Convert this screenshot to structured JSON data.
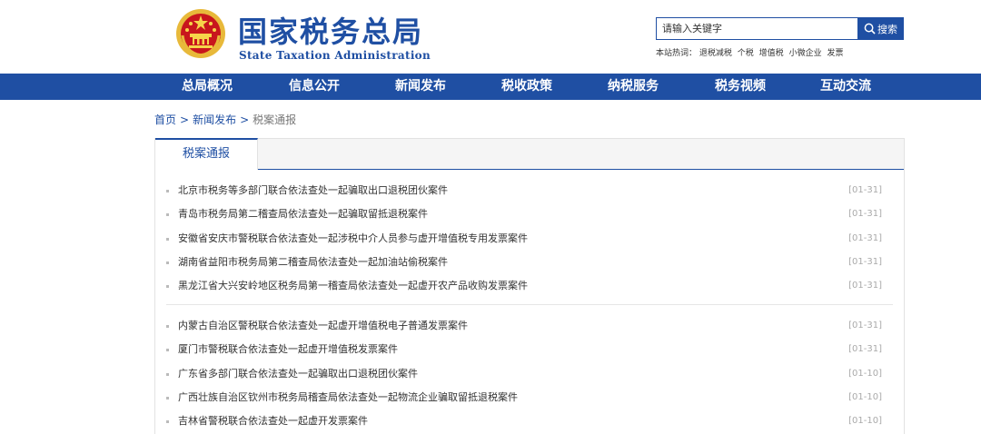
{
  "header": {
    "title_cn": "国家税务总局",
    "title_en": "State Taxation Administration",
    "search_placeholder": "请输入关键字",
    "search_button": "搜索",
    "hot_label": "本站热词：",
    "hot_words": [
      "退税减税",
      "个税",
      "增值税",
      "小微企业",
      "发票"
    ]
  },
  "nav": [
    "总局概况",
    "信息公开",
    "新闻发布",
    "税收政策",
    "纳税服务",
    "税务视频",
    "互动交流"
  ],
  "breadcrumb": {
    "home": "首页",
    "news": "新闻发布",
    "current": "税案通报",
    "separator": ">"
  },
  "tab": {
    "label": "税案通报"
  },
  "group_a": [
    {
      "title": "北京市税务等多部门联合依法查处一起骗取出口退税团伙案件",
      "date": "[01-31]"
    },
    {
      "title": "青岛市税务局第二稽查局依法查处一起骗取留抵退税案件",
      "date": "[01-31]"
    },
    {
      "title": "安徽省安庆市警税联合依法查处一起涉税中介人员参与虚开增值税专用发票案件",
      "date": "[01-31]"
    },
    {
      "title": "湖南省益阳市税务局第二稽查局依法查处一起加油站偷税案件",
      "date": "[01-31]"
    },
    {
      "title": "黑龙江省大兴安岭地区税务局第一稽查局依法查处一起虚开农产品收购发票案件",
      "date": "[01-31]"
    }
  ],
  "group_b": [
    {
      "title": "内蒙古自治区警税联合依法查处一起虚开增值税电子普通发票案件",
      "date": "[01-31]"
    },
    {
      "title": "厦门市警税联合依法查处一起虚开增值税发票案件",
      "date": "[01-31]"
    },
    {
      "title": "广东省多部门联合依法查处一起骗取出口退税团伙案件",
      "date": "[01-10]"
    },
    {
      "title": "广西壮族自治区钦州市税务局稽查局依法查处一起物流企业骗取留抵退税案件",
      "date": "[01-10]"
    },
    {
      "title": "吉林省警税联合依法查处一起虚开发票案件",
      "date": "[01-10]"
    }
  ]
}
